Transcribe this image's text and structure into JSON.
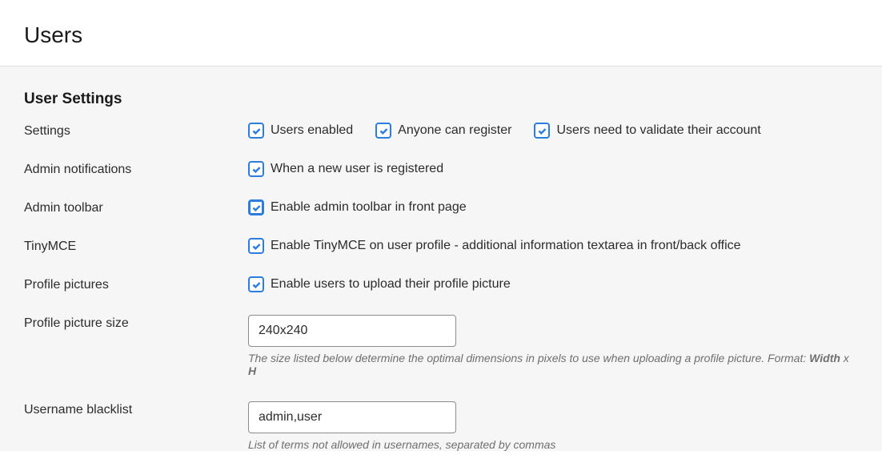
{
  "header": {
    "title": "Users"
  },
  "section": {
    "title": "User Settings"
  },
  "rows": {
    "settings": {
      "label": "Settings",
      "checkboxes": {
        "users_enabled": "Users enabled",
        "anyone_register": "Anyone can register",
        "validate_account": "Users need to validate their account"
      }
    },
    "admin_notifications": {
      "label": "Admin notifications",
      "checkbox": "When a new user is registered"
    },
    "admin_toolbar": {
      "label": "Admin toolbar",
      "checkbox": "Enable admin toolbar in front page"
    },
    "tinymce": {
      "label": "TinyMCE",
      "checkbox": "Enable TinyMCE on user profile - additional information textarea in front/back office"
    },
    "profile_pictures": {
      "label": "Profile pictures",
      "checkbox": "Enable users to upload their profile picture"
    },
    "profile_picture_size": {
      "label": "Profile picture size",
      "value": "240x240",
      "help_prefix": "The size listed below determine the optimal dimensions in pixels to use when uploading a profile picture. Format: ",
      "help_bold1": "Width",
      "help_mid": " x ",
      "help_bold2": "H"
    },
    "username_blacklist": {
      "label": "Username blacklist",
      "value": "admin,user",
      "help": "List of terms not allowed in usernames, separated by commas"
    }
  }
}
